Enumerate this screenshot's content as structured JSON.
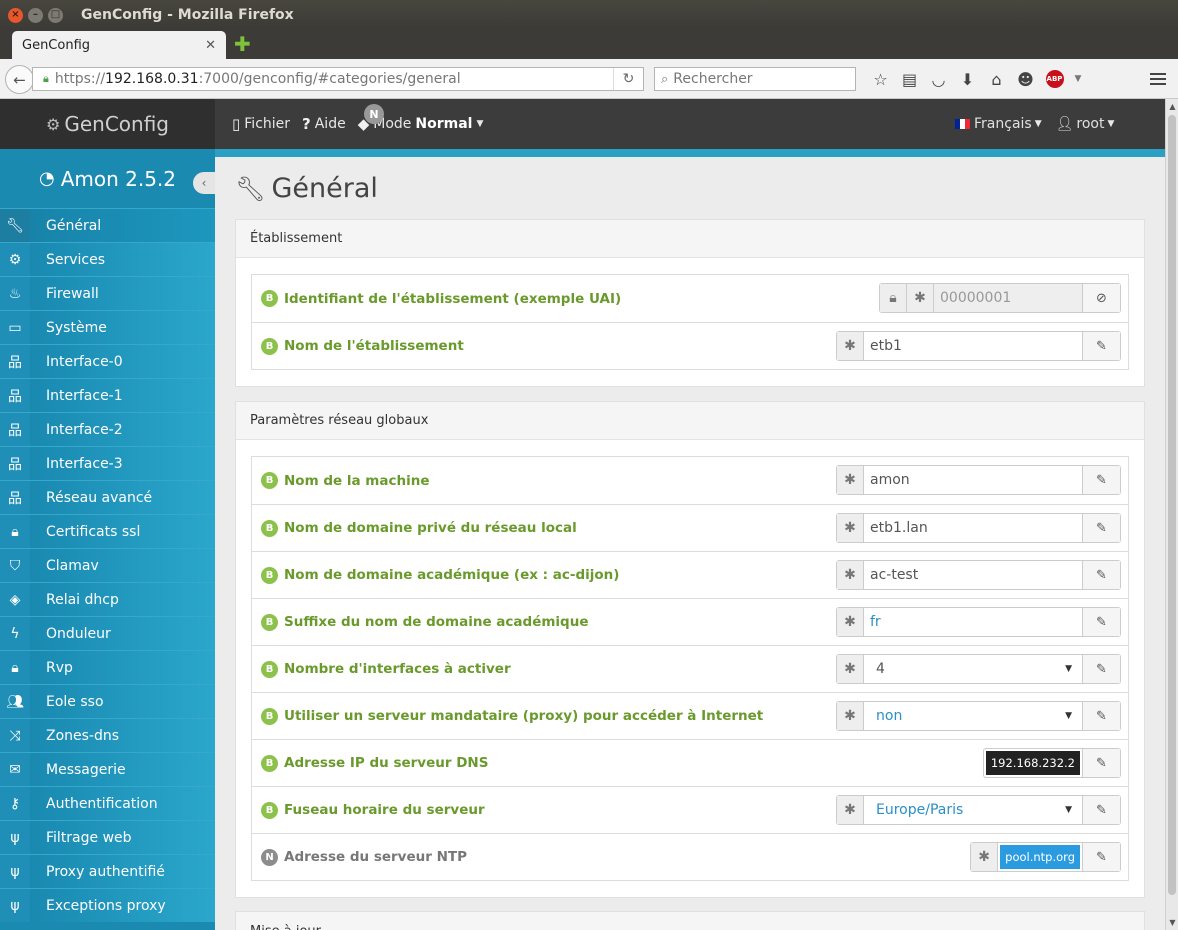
{
  "window": {
    "title": "GenConfig - Mozilla Firefox"
  },
  "browser": {
    "tab_title": "GenConfig",
    "tab_close": "✕",
    "url_scheme": "https://",
    "url_host": "192.168.0.31",
    "url_rest": ":7000/genconfig/#categories/general",
    "search_placeholder": "Rechercher"
  },
  "app": {
    "brand": "GenConfig",
    "nav": {
      "fichier": "Fichier",
      "aide": "Aide",
      "mode_label": "Mode",
      "mode_value": "Normal",
      "mode_badge": "N"
    },
    "language": "Français",
    "user": "root",
    "flag_colors": [
      "#002395",
      "#ffffff",
      "#ed2939"
    ]
  },
  "sidebar": {
    "title": "Amon 2.5.2",
    "items": [
      {
        "label": "Général",
        "icon": "wrench-icon",
        "active": true
      },
      {
        "label": "Services",
        "icon": "cogs-icon"
      },
      {
        "label": "Firewall",
        "icon": "fire-icon"
      },
      {
        "label": "Système",
        "icon": "desktop-icon"
      },
      {
        "label": "Interface-0",
        "icon": "sitemap-icon"
      },
      {
        "label": "Interface-1",
        "icon": "sitemap-icon"
      },
      {
        "label": "Interface-2",
        "icon": "sitemap-icon"
      },
      {
        "label": "Interface-3",
        "icon": "sitemap-icon"
      },
      {
        "label": "Réseau avancé",
        "icon": "sitemap-icon"
      },
      {
        "label": "Certificats ssl",
        "icon": "lock-icon"
      },
      {
        "label": "Clamav",
        "icon": "shield-icon"
      },
      {
        "label": "Relai dhcp",
        "icon": "tags-icon"
      },
      {
        "label": "Onduleur",
        "icon": "bolt-icon"
      },
      {
        "label": "Rvp",
        "icon": "lock-icon"
      },
      {
        "label": "Eole sso",
        "icon": "users-icon"
      },
      {
        "label": "Zones-dns",
        "icon": "random-icon"
      },
      {
        "label": "Messagerie",
        "icon": "envelope-icon"
      },
      {
        "label": "Authentification",
        "icon": "key-icon"
      },
      {
        "label": "Filtrage web",
        "icon": "fork-icon"
      },
      {
        "label": "Proxy authentifié",
        "icon": "fork-icon"
      },
      {
        "label": "Exceptions proxy",
        "icon": "fork-icon"
      }
    ]
  },
  "page": {
    "title": "Général",
    "panels": [
      {
        "heading": "Établissement",
        "fields": [
          {
            "badge": "B",
            "label": "Identifiant de l'établissement (exemple UAI)",
            "value": "00000001",
            "kind": "locked"
          },
          {
            "badge": "B",
            "label": "Nom de l'établissement",
            "value": "etb1",
            "kind": "text"
          }
        ]
      },
      {
        "heading": "Paramètres réseau globaux",
        "fields": [
          {
            "badge": "B",
            "label": "Nom de la machine",
            "value": "amon",
            "kind": "text"
          },
          {
            "badge": "B",
            "label": "Nom de domaine privé du réseau local",
            "value": "etb1.lan",
            "kind": "text"
          },
          {
            "badge": "B",
            "label": "Nom de domaine académique (ex : ac-dijon)",
            "value": "ac-test",
            "kind": "text"
          },
          {
            "badge": "B",
            "label": "Suffixe du nom de domaine académique",
            "value": "fr",
            "kind": "text-blue"
          },
          {
            "badge": "B",
            "label": "Nombre d'interfaces à activer",
            "value": "4",
            "kind": "select"
          },
          {
            "badge": "B",
            "label": "Utiliser un serveur mandataire (proxy) pour accéder à Internet",
            "value": "non",
            "kind": "select-blue"
          },
          {
            "badge": "B",
            "label": "Adresse IP du serveur DNS",
            "value": "192.168.232.2",
            "kind": "tag-dark"
          },
          {
            "badge": "B",
            "label": "Fuseau horaire du serveur",
            "value": "Europe/Paris",
            "kind": "select-blue"
          },
          {
            "badge": "N",
            "label": "Adresse du serveur NTP",
            "value": "pool.ntp.org",
            "kind": "tag-blue"
          }
        ]
      },
      {
        "heading": "Mise à jour"
      }
    ]
  }
}
